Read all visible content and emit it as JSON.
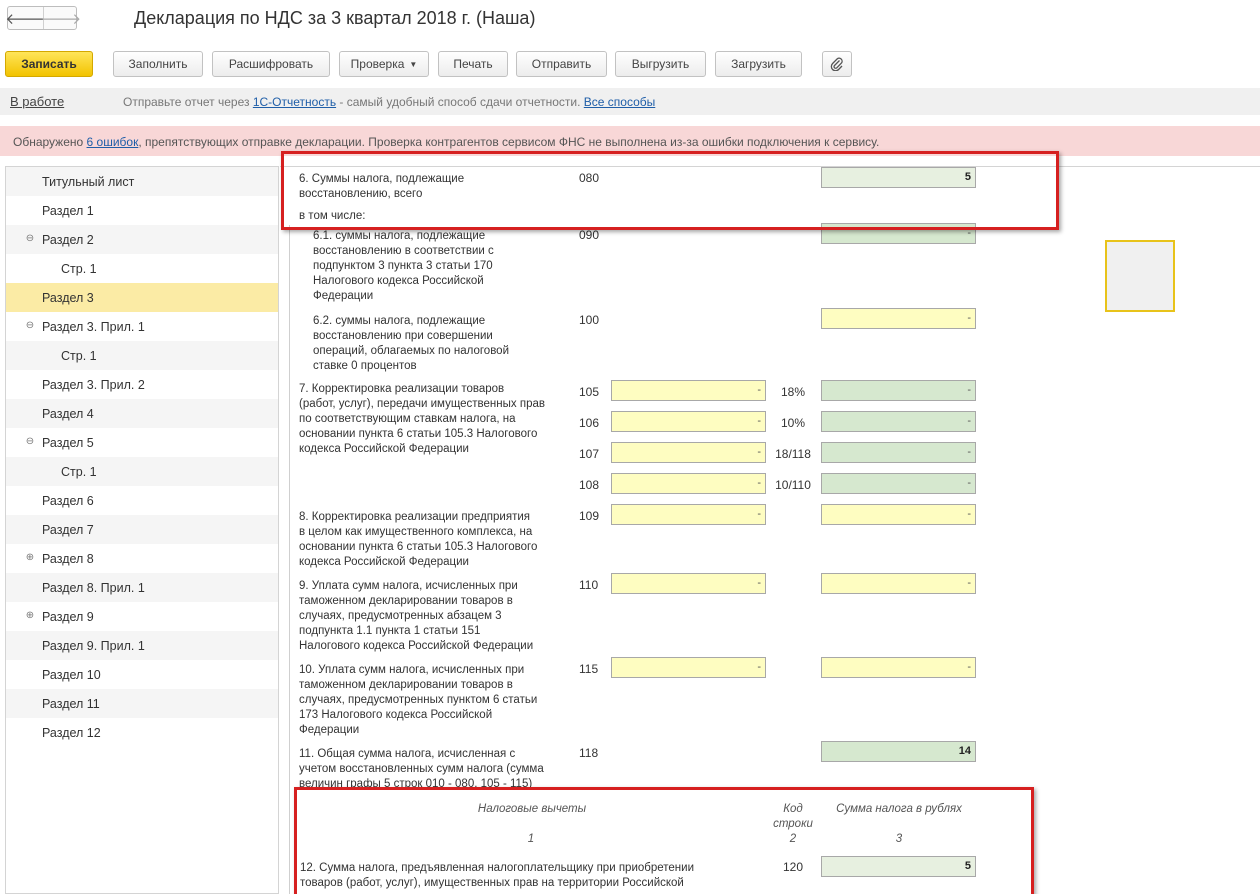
{
  "header": {
    "back_icon": "arrow-left-icon",
    "forward_icon": "arrow-right-icon",
    "title": "Декларация по НДС за 3 квартал 2018 г. (Наша)"
  },
  "toolbar": {
    "save": "Записать",
    "fill": "Заполнить",
    "decode": "Расшифровать",
    "check": "Проверка",
    "print": "Печать",
    "send": "Отправить",
    "export": "Выгрузить",
    "import": "Загрузить",
    "attach_icon": "paperclip-icon"
  },
  "status": {
    "label": "В работе",
    "text_before": "Отправьте отчет через ",
    "link1": "1С-Отчетность",
    "text_middle": " - самый удобный способ сдачи отчетности. ",
    "link2": "Все способы"
  },
  "error": {
    "text_before": "Обнаружено ",
    "link": "6 ошибок",
    "text_after": ", препятствующих отправке декларации. Проверка контрагентов сервисом ФНС не выполнена из-за ошибки подключения к сервису."
  },
  "sidebar": {
    "items": [
      {
        "label": "Титульный лист"
      },
      {
        "label": "Раздел 1"
      },
      {
        "label": "Раздел 2",
        "toggle": "⊖"
      },
      {
        "label": "Стр. 1"
      },
      {
        "label": "Раздел 3"
      },
      {
        "label": "Раздел 3. Прил. 1",
        "toggle": "⊖"
      },
      {
        "label": "Стр. 1"
      },
      {
        "label": "Раздел 3. Прил. 2"
      },
      {
        "label": "Раздел 4"
      },
      {
        "label": "Раздел 5",
        "toggle": "⊖"
      },
      {
        "label": "Стр. 1"
      },
      {
        "label": "Раздел 6"
      },
      {
        "label": "Раздел 7"
      },
      {
        "label": "Раздел 8",
        "toggle": "⊕"
      },
      {
        "label": "Раздел 8. Прил. 1"
      },
      {
        "label": "Раздел 9",
        "toggle": "⊕"
      },
      {
        "label": "Раздел 9. Прил. 1"
      },
      {
        "label": "Раздел 10"
      },
      {
        "label": "Раздел 11"
      },
      {
        "label": "Раздел 12"
      }
    ]
  },
  "form": {
    "r6": {
      "label": "6. Суммы налога, подлежащие\nвосстановлению, всего",
      "code": "080",
      "value": "5"
    },
    "incl": "в том числе:",
    "r61": {
      "label": "6.1. суммы налога, подлежащие\nвосстановлению в соответствии с\nподпунктом 3 пункта 3 статьи 170\nНалогового кодекса Российской\nФедерации",
      "code": "090",
      "value": "-"
    },
    "r62": {
      "label": "6.2. суммы налога, подлежащие\nвосстановлению при совершении\nопераций, облагаемых по налоговой\nставке 0 процентов",
      "code": "100",
      "value": "-"
    },
    "r7": {
      "label": "7. Корректировка реализации товаров\n(работ, услуг), передачи имущественных прав\nпо соответствующим ставкам налога, на\nосновании пункта 6 статьи 105.3 Налогового\nкодекса Российской Федерации",
      "rows": [
        {
          "code": "105",
          "base": "-",
          "rate": "18%",
          "tax": "-"
        },
        {
          "code": "106",
          "base": "-",
          "rate": "10%",
          "tax": "-"
        },
        {
          "code": "107",
          "base": "-",
          "rate": "18/118",
          "tax": "-"
        },
        {
          "code": "108",
          "base": "-",
          "rate": "10/110",
          "tax": "-"
        }
      ]
    },
    "r8": {
      "label": "8. Корректировка реализации предприятия\nв целом как имущественного комплекса, на\nосновании пункта 6 статьи 105.3 Налогового\nкодекса Российской Федерации",
      "code": "109",
      "base": "-",
      "tax": "-"
    },
    "r9": {
      "label": "9. Уплата сумм налога, исчисленных при\nтаможенном декларировании товаров в\nслучаях, предусмотренных абзацем 3\nподпункта 1.1 пункта 1 статьи 151\nНалогового кодекса Российской Федерации",
      "code": "110",
      "base": "-",
      "tax": "-"
    },
    "r10": {
      "label": "10. Уплата сумм налога, исчисленных при\nтаможенном декларировании товаров в\nслучаях, предусмотренных пунктом 6 статьи\n173 Налогового кодекса Российской\nФедерации",
      "code": "115",
      "base": "-",
      "tax": "-"
    },
    "r11": {
      "label": "11. Общая сумма налога, исчисленная с\nучетом восстановленных сумм налога (сумма\nвеличин графы 5 строк 010 - 080, 105 - 115)",
      "code": "118",
      "value": "14"
    },
    "deductions_header": {
      "col1": "Налоговые вычеты",
      "col2": "Код\nстроки",
      "col3": "Сумма налога в рублях",
      "num1": "1",
      "num2": "2",
      "num3": "3"
    },
    "r12": {
      "label": "12. Сумма налога, предъявленная налогоплательщику при приобретении\nтоваров (работ, услуг), имущественных прав на территории Российской",
      "code": "120",
      "value": "5"
    }
  }
}
